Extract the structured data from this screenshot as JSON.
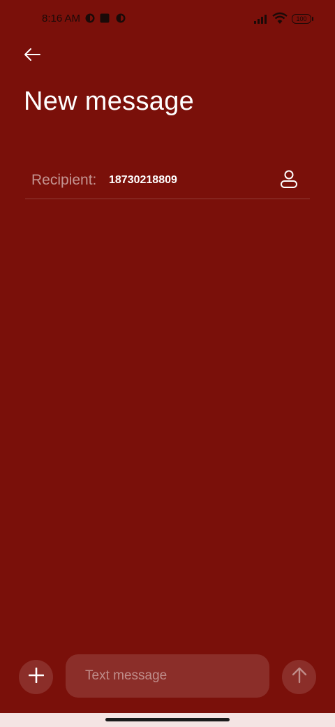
{
  "status_bar": {
    "time": "8:16 AM",
    "battery": "100",
    "icons": [
      "notification-icon",
      "square-icon",
      "notification-icon",
      "signal-icon",
      "wifi-icon",
      "battery-icon"
    ]
  },
  "header": {
    "back_icon": "arrow-left-icon",
    "title": "New message"
  },
  "recipient": {
    "label": "Recipient:",
    "value": "18730218809",
    "contact_icon": "person-icon"
  },
  "composer": {
    "attach_icon": "plus-icon",
    "placeholder": "Text message",
    "send_icon": "arrow-up-icon"
  },
  "colors": {
    "background": "#7a100a",
    "nav_bar": "#f4e4e3"
  }
}
